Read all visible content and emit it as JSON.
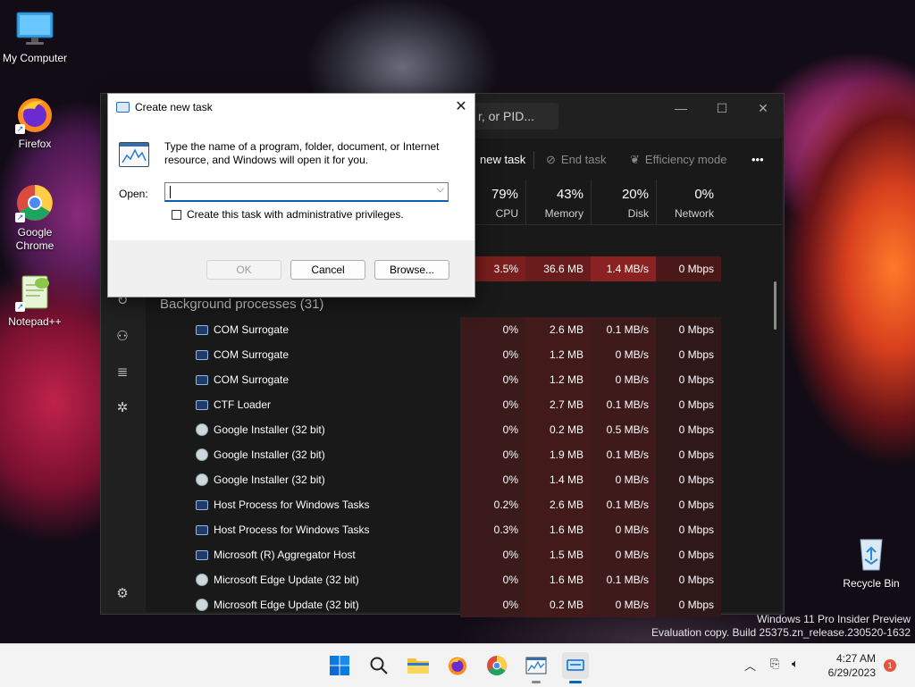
{
  "desktop": {
    "icons": [
      {
        "label": "My Computer"
      },
      {
        "label": "Firefox"
      },
      {
        "label": "Google Chrome"
      },
      {
        "label": "Notepad++"
      },
      {
        "label": "Recycle Bin"
      }
    ],
    "watermark": {
      "line1": "Windows 11 Pro Insider Preview",
      "line2": "Evaluation copy. Build 25375.zn_release.230520-1632"
    }
  },
  "task_manager": {
    "search_partial": "r, or PID...",
    "toolbar": {
      "new_task": "new task",
      "end_task": "End task",
      "efficiency_mode": "Efficiency mode",
      "more": "•••"
    },
    "columns": [
      {
        "pct": "79%",
        "label": "CPU"
      },
      {
        "pct": "43%",
        "label": "Memory"
      },
      {
        "pct": "20%",
        "label": "Disk"
      },
      {
        "pct": "0%",
        "label": "Network"
      }
    ],
    "app_row": {
      "cpu": "3.5%",
      "memory": "36.6 MB",
      "disk": "1.4 MB/s",
      "network": "0 Mbps"
    },
    "background_group": "Background processes (31)",
    "processes": [
      {
        "name": "COM Surrogate",
        "cpu": "0%",
        "memory": "2.6 MB",
        "disk": "0.1 MB/s",
        "network": "0 Mbps",
        "icon": "window"
      },
      {
        "name": "COM Surrogate",
        "cpu": "0%",
        "memory": "1.2 MB",
        "disk": "0 MB/s",
        "network": "0 Mbps",
        "icon": "window"
      },
      {
        "name": "COM Surrogate",
        "cpu": "0%",
        "memory": "1.2 MB",
        "disk": "0 MB/s",
        "network": "0 Mbps",
        "icon": "window"
      },
      {
        "name": "CTF Loader",
        "cpu": "0%",
        "memory": "2.7 MB",
        "disk": "0.1 MB/s",
        "network": "0 Mbps",
        "icon": "window"
      },
      {
        "name": "Google Installer (32 bit)",
        "cpu": "0%",
        "memory": "0.2 MB",
        "disk": "0.5 MB/s",
        "network": "0 Mbps",
        "icon": "installer"
      },
      {
        "name": "Google Installer (32 bit)",
        "cpu": "0%",
        "memory": "1.9 MB",
        "disk": "0.1 MB/s",
        "network": "0 Mbps",
        "icon": "installer"
      },
      {
        "name": "Google Installer (32 bit)",
        "cpu": "0%",
        "memory": "1.4 MB",
        "disk": "0 MB/s",
        "network": "0 Mbps",
        "icon": "installer"
      },
      {
        "name": "Host Process for Windows Tasks",
        "cpu": "0.2%",
        "memory": "2.6 MB",
        "disk": "0.1 MB/s",
        "network": "0 Mbps",
        "icon": "window"
      },
      {
        "name": "Host Process for Windows Tasks",
        "cpu": "0.3%",
        "memory": "1.6 MB",
        "disk": "0 MB/s",
        "network": "0 Mbps",
        "icon": "window"
      },
      {
        "name": "Microsoft (R) Aggregator Host",
        "cpu": "0%",
        "memory": "1.5 MB",
        "disk": "0 MB/s",
        "network": "0 Mbps",
        "icon": "window"
      },
      {
        "name": "Microsoft Edge Update (32 bit)",
        "cpu": "0%",
        "memory": "1.6 MB",
        "disk": "0.1 MB/s",
        "network": "0 Mbps",
        "icon": "installer"
      },
      {
        "name": "Microsoft Edge Update (32 bit)",
        "cpu": "0%",
        "memory": "0.2 MB",
        "disk": "0 MB/s",
        "network": "0 Mbps",
        "icon": "installer"
      }
    ]
  },
  "dialog": {
    "title": "Create new task",
    "description": "Type the name of a program, folder, document, or Internet resource, and Windows will open it for you.",
    "open_label": "Open:",
    "open_value": "",
    "admin_checkbox_label": "Create this task with administrative privileges.",
    "admin_checked": false,
    "ok_label": "OK",
    "cancel_label": "Cancel",
    "browse_label": "Browse..."
  },
  "taskbar": {
    "time": "4:27 AM",
    "date": "6/29/2023",
    "notification_count": "1",
    "accent": "#0067c0"
  }
}
